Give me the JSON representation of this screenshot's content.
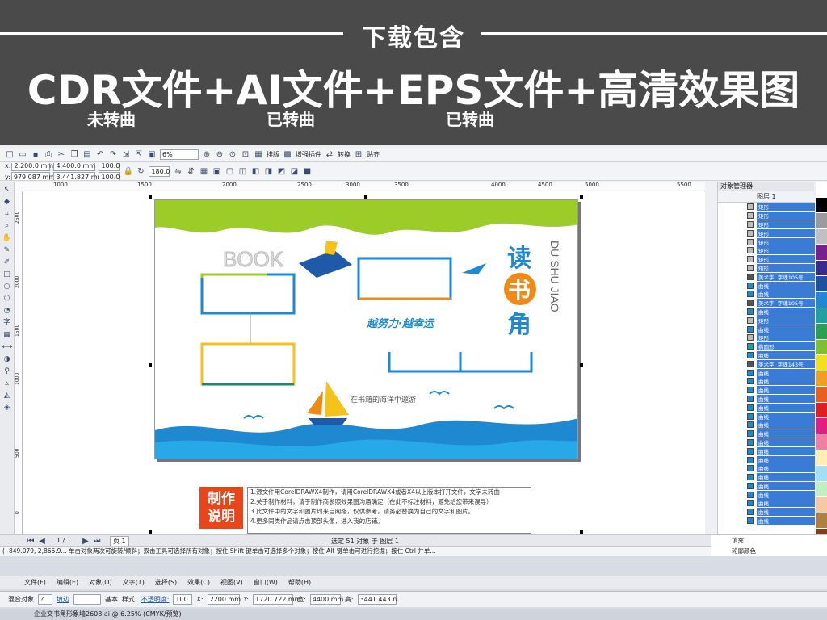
{
  "banner": {
    "heading": "下载包含",
    "main": "CDR文件+AI文件+EPS文件+高清效果图",
    "sub1": "未转曲",
    "sub2": "已转曲",
    "sub3": "已转曲"
  },
  "toolbar": {
    "zoom": "6%",
    "btn_arrange": "排版",
    "btn_plugins": "增强插件",
    "btn_convert": "转换",
    "btn_paste": "贴齐"
  },
  "propbar": {
    "x": "2,200.0 mm",
    "y": "979.087 mm",
    "w": "4,400.0 mm",
    "h": "3,441.827 mm",
    "sx": "100.0",
    "sy": "100.0",
    "pct": "%",
    "angle": "180.0"
  },
  "ruler_h": [
    "1000",
    "1500",
    "2000",
    "2500",
    "3000",
    "3500",
    "4000",
    "4500",
    "5000",
    "5500"
  ],
  "ruler_v": [
    "2500",
    "2000",
    "1500",
    "1000",
    "500",
    "0"
  ],
  "canvas": {
    "book": "BOOK",
    "du": "读",
    "shu": "书",
    "jiao": "角",
    "pinyin": "DU SHU JIAO",
    "slogan": "越努力·越幸运",
    "sea_text": "在书籍的海洋中遨游",
    "make_label": "制作说明",
    "notes": [
      "1.源文件用CorelDRAWX4制作，请用CorelDRAWX4或者X4以上版本打开文件，文字未转曲",
      "2.关于制作材料，请于制作商参照效果图沟通确定（在此不标注材料，避免给您带来误导）",
      "3.此文件中的文字和图片均来自网络，仅供参考，请务必替换为自己的文字和图片。",
      "4.更多同类作品请点击顶部头像，进入我的店铺。"
    ]
  },
  "status": {
    "page_counter": "1 / 1",
    "page_tab": "页 1",
    "selection": "选定 51 对象 于 图层 1",
    "hint": "( -849.079, 2,866.9...    单击对象两次可旋转/倾斜；双击工具可选择所有对象；按住 Shift 键单击可选择多个对象；按住 Alt 键单击可进行挖掘；按住 Ctrl 并单..."
  },
  "objects_panel": {
    "title": "对象管理器",
    "layer": "图层 1",
    "fill_label": "填充",
    "outline_label": "轮廓颜色",
    "rows": [
      {
        "icon": "rect",
        "label": "矩形"
      },
      {
        "icon": "rect",
        "label": "矩形"
      },
      {
        "icon": "rect",
        "label": "矩形"
      },
      {
        "icon": "rect",
        "label": "矩形"
      },
      {
        "icon": "rect",
        "label": "矩形"
      },
      {
        "icon": "rect",
        "label": "矩形"
      },
      {
        "icon": "rect",
        "label": "矩形"
      },
      {
        "icon": "rect",
        "label": "矩形"
      },
      {
        "icon": "text",
        "label": "美术字: 字魂105号"
      },
      {
        "icon": "curve",
        "label": "曲线"
      },
      {
        "icon": "curve",
        "label": "曲线"
      },
      {
        "icon": "text",
        "label": "美术字: 字魂105号"
      },
      {
        "icon": "curve",
        "label": "曲线"
      },
      {
        "icon": "rect",
        "label": "矩形"
      },
      {
        "icon": "curve",
        "label": "曲线"
      },
      {
        "icon": "rect",
        "label": "矩形"
      },
      {
        "icon": "ellipse",
        "label": "椭圆形"
      },
      {
        "icon": "curve",
        "label": "曲线"
      },
      {
        "icon": "text",
        "label": "美术字: 字魂143号"
      },
      {
        "icon": "curve",
        "label": "曲线"
      },
      {
        "icon": "curve",
        "label": "曲线"
      },
      {
        "icon": "curve",
        "label": "曲线"
      },
      {
        "icon": "curve",
        "label": "曲线"
      },
      {
        "icon": "curve",
        "label": "曲线"
      },
      {
        "icon": "curve",
        "label": "曲线"
      },
      {
        "icon": "curve",
        "label": "曲线"
      },
      {
        "icon": "curve",
        "label": "曲线"
      },
      {
        "icon": "curve",
        "label": "曲线"
      },
      {
        "icon": "curve",
        "label": "曲线"
      },
      {
        "icon": "curve",
        "label": "曲线"
      },
      {
        "icon": "curve",
        "label": "曲线"
      },
      {
        "icon": "curve",
        "label": "曲线"
      },
      {
        "icon": "curve",
        "label": "曲线"
      },
      {
        "icon": "curve",
        "label": "曲线"
      },
      {
        "icon": "curve",
        "label": "曲线"
      },
      {
        "icon": "curve",
        "label": "曲线"
      },
      {
        "icon": "curve",
        "label": "曲线"
      }
    ]
  },
  "palette_colors": [
    "#ffffff",
    "#000000",
    "#9b9b9b",
    "#c0c0c0",
    "#7a1f8c",
    "#3a2a8c",
    "#1e50a0",
    "#1e88d0",
    "#20a0a0",
    "#2aa050",
    "#80c030",
    "#f0e020",
    "#f0a020",
    "#e86020",
    "#e02020",
    "#e02080",
    "#f080a0",
    "#fff0b0",
    "#a0e0f0",
    "#c0f0c0",
    "#f8c8a0",
    "#b08040",
    "#804020"
  ],
  "x4": {
    "menu": [
      "文件(F)",
      "编辑(E)",
      "对象(O)",
      "文字(T)",
      "选择(S)",
      "效果(C)",
      "视图(V)",
      "窗口(W)",
      "帮助(H)"
    ],
    "blend_label": "混合对象",
    "fill_tab": "填边",
    "line_label": "基本",
    "style_label": "样式:",
    "opacity_label": "不透明度:",
    "opacity_value": "100",
    "x_label": "X:",
    "x_value": "2200 mm",
    "y_label": "Y:",
    "y_value": "1720.722 mm",
    "w_label": "宽:",
    "w_value": "4400 mm",
    "h_label": "高:",
    "h_value": "3441.443 n",
    "doc_tab": "企业文书角形象墙2608.ai @ 6.25% (CMYK/预览)"
  },
  "colors": {
    "green": "#9ccc27",
    "blue": "#1e88d0",
    "orange": "#f08a16",
    "yellow": "#f5c21a",
    "teal": "#1b8a6b",
    "red": "#e8451a"
  }
}
